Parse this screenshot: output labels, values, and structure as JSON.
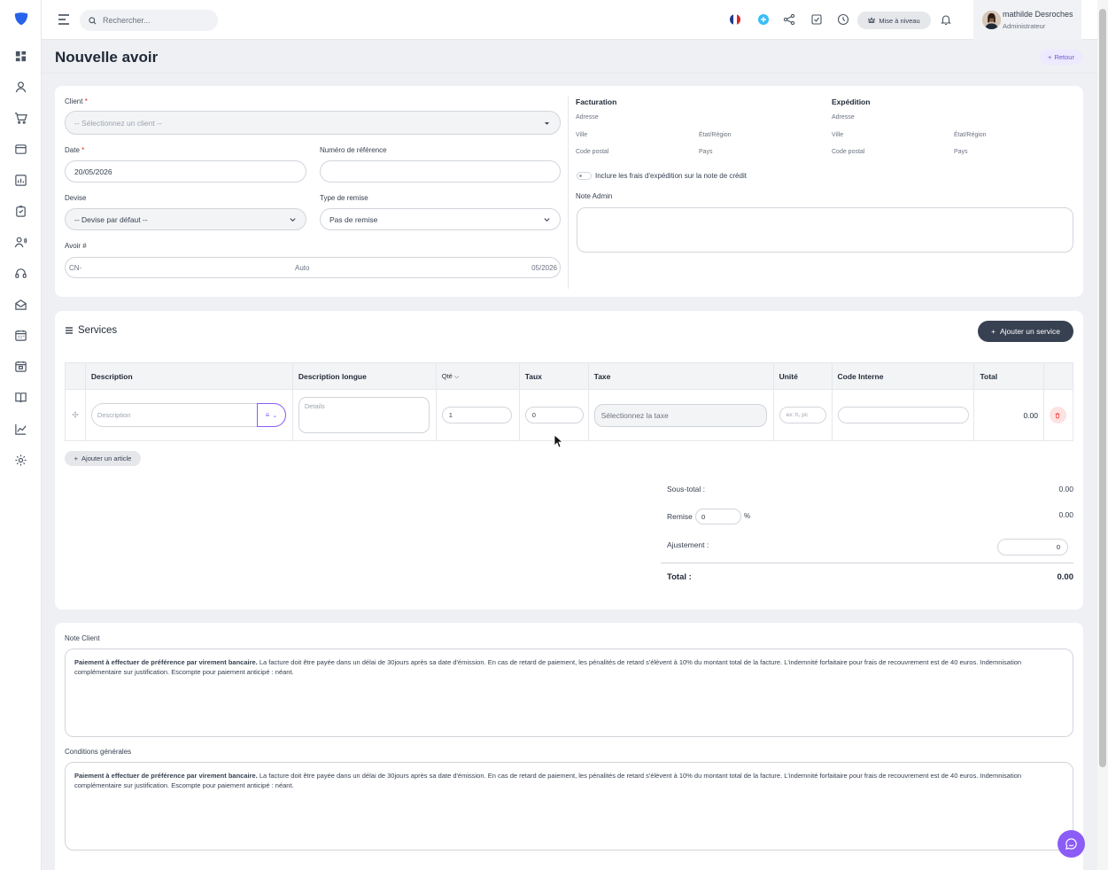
{
  "topbar": {
    "search_placeholder": "Rechercher...",
    "upgrade_label": "Mise à niveau",
    "user_name": "mathilde Desroches",
    "user_role": "Administrateur"
  },
  "page": {
    "title": "Nouvelle avoir",
    "back_label": "Retour"
  },
  "form": {
    "client_label": "Client",
    "client_placeholder": "-- Sélectionnez un client --",
    "date_label": "Date",
    "date_value": "20/05/2026",
    "ref_label": "Numéro de référence",
    "ref_value": "",
    "currency_label": "Devise",
    "currency_value": "-- Devise par défaut --",
    "discount_type_label": "Type de remise",
    "discount_type_value": "Pas de remise",
    "credit_label": "Avoir #",
    "credit_prefix": "CN-",
    "credit_auto": "Auto",
    "credit_suffix": "05/2026"
  },
  "billing": {
    "title": "Facturation",
    "address": "Adresse",
    "city": "Ville",
    "state": "État/Région",
    "zip": "Code postal",
    "country": "Pays"
  },
  "shipping": {
    "title": "Expédition",
    "address": "Adresse",
    "city": "Ville",
    "state": "État/Région",
    "zip": "Code postal",
    "country": "Pays"
  },
  "shipping_toggle_label": "Inclure les frais d'expédition sur la note de crédit",
  "admin_note_label": "Note Admin",
  "services": {
    "title": "Services",
    "add_service_label": "Ajouter un service",
    "headers": {
      "description": "Description",
      "long_description": "Description longue",
      "qty": "Qté",
      "rate": "Taux",
      "tax": "Taxe",
      "unit": "Unité",
      "internal_code": "Code Interne",
      "total": "Total"
    },
    "row": {
      "description_placeholder": "Description",
      "details_placeholder": "Details",
      "qty": "1",
      "rate": "0",
      "tax_placeholder": "Sélectionnez la taxe",
      "unit_placeholder": "ex: h, pc",
      "total": "0.00"
    },
    "add_item_label": "Ajouter un article"
  },
  "totals": {
    "subtotal_label": "Sous-total :",
    "subtotal_value": "0.00",
    "discount_label": "Remise",
    "discount_input": "0",
    "discount_unit": "%",
    "discount_value": "0.00",
    "adjustment_label": "Ajustement :",
    "adjustment_value": "0",
    "total_label": "Total :",
    "total_value": "0.00"
  },
  "notes": {
    "client_note_label": "Note Client",
    "terms_label": "Conditions générales",
    "text_bold": "Paiement à effectuer de préférence par virement bancaire.",
    "text_rest": " La facture doit être payée dans un délai de 30jours après sa date d'émission. En cas de retard de paiement, les pénalités de retard s'élèvent à 10% du montant total de la facture. L'indemnité forfaitaire pour frais de recouvrement est de 40 euros. Indemnisation complémentaire sur justification. Escompte pour paiement anticipé : néant."
  },
  "colors": {
    "accent": "#8b5cf6",
    "dark_button": "#374151",
    "logo": "#2563eb"
  }
}
